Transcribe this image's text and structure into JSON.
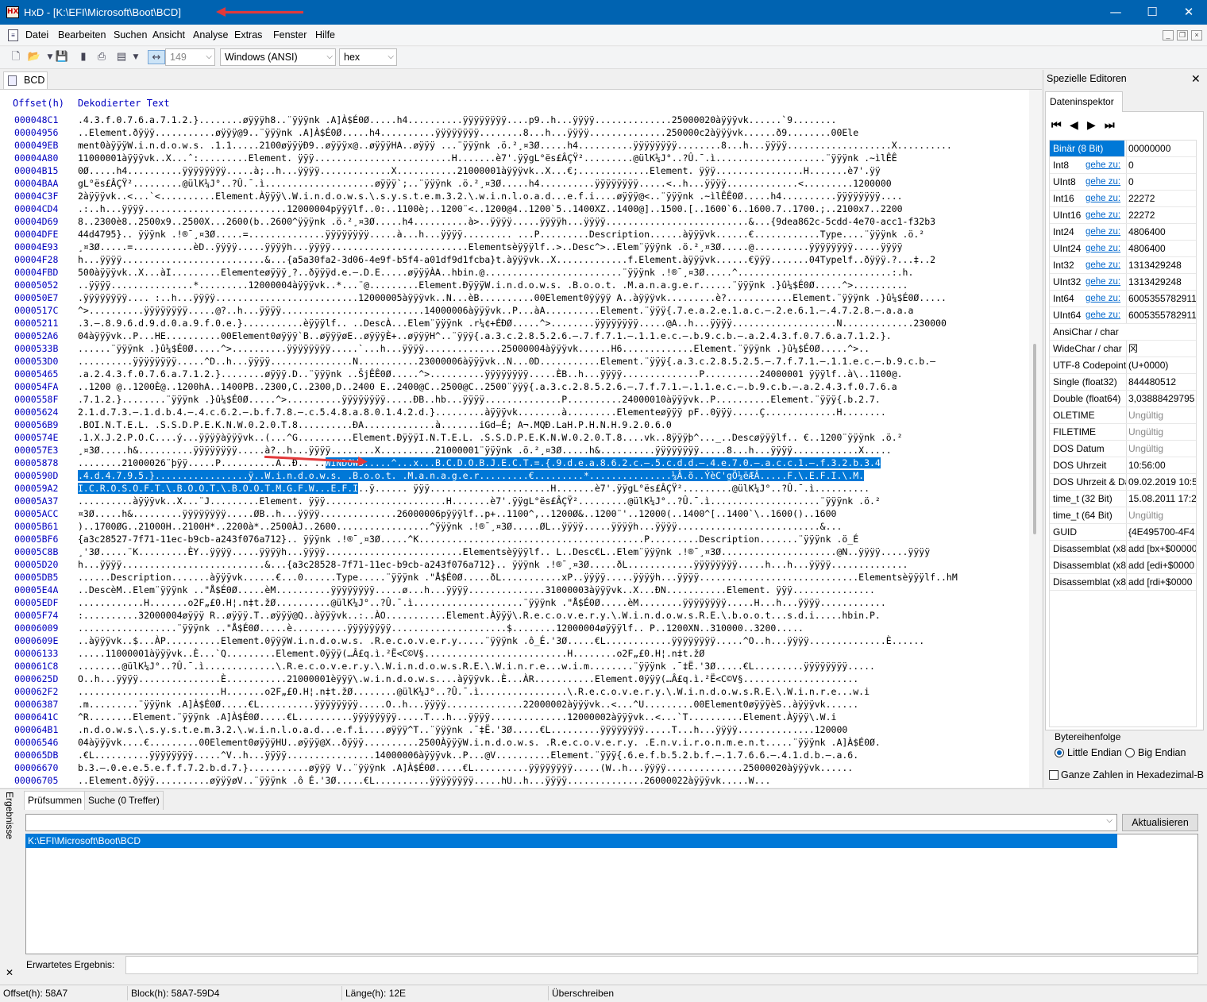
{
  "window": {
    "title": "HxD - [K:\\EFI\\Microsoft\\Boot\\BCD]",
    "app_icon": "hxd-icon",
    "minimize": "—",
    "maximize": "☐",
    "close": "✕"
  },
  "menu": [
    "Datei",
    "Bearbeiten",
    "Suchen",
    "Ansicht",
    "Analyse",
    "Extras",
    "Fenster",
    "Hilfe"
  ],
  "toolbar": {
    "bytes_per_row": "149",
    "charset": "Windows (ANSI)",
    "mode": "hex"
  },
  "document_tab": "BCD",
  "editor": {
    "header_offset": "Offset(h)",
    "header_text": "Dekodierter Text",
    "rows": [
      {
        "off": "000048C1",
        "txt": ".4.3.f.0.7.6.a.7.1.2.}........øÿÿÿh8..¨ÿÿÿnk .A]À$É0Ø.....h4..........ÿÿÿÿÿÿÿÿ....p9..h...ÿÿÿÿ..............25000020àÿÿÿvk......`9........"
      },
      {
        "off": "00004956",
        "txt": "..Element.ðÿÿÿ...........øÿÿÿ@9..¨ÿÿÿnk .A]À$É0Ø.....h4..........ÿÿÿÿÿÿÿÿ........8...h...ÿÿÿÿ..............250000c2àÿÿÿvk......ð9........00Ele"
      },
      {
        "off": "000049EB",
        "txt": "ment0àÿÿÿW.i.n.d.o.w.s. .1.1.....2100øÿÿÿÐ9..øÿÿÿx@..øÿÿÿHA..øÿÿÿ ...¨ÿÿÿnk .ö.²¸¤3Ø.....h4..........ÿÿÿÿÿÿÿÿ........8...h...ÿÿÿÿ...................X.........."
      },
      {
        "off": "00004A80",
        "txt": "11000001àÿÿÿvk..X...ˆ:.........Element. ÿÿÿ.........................H.......è7'.ÿÿgL°ës£ÂÇŸ².........@ülK¼J°..?Û.¯.ì....................¨ÿÿÿnk .~ìlÊÊ"
      },
      {
        "off": "00004B15",
        "txt": "0Ø.....h4..........ÿÿÿÿÿÿÿÿ.....à;..h...ÿÿÿÿ.............X...........21000001àÿÿÿvk..X...€;.............Element. ÿÿÿ................H.......è7'.ÿÿ"
      },
      {
        "off": "00004BAA",
        "txt": "gL°ës£ÂÇŸ².........@ülK¼J°..?Û.¯.ì....................øÿÿÿ`;..¨ÿÿÿnk .ö.²¸¤3Ø.....h4..........ÿÿÿÿÿÿÿÿ.....<..h...ÿÿÿÿ.............<.........1200000"
      },
      {
        "off": "00004C3F",
        "txt": "2àÿÿÿvk..<...`<..........Element.Àÿÿÿ\\.W.i.n.d.o.w.s.\\.s.y.s.t.e.m.3.2.\\.w.i.n.l.o.a.d...e.f.i....øÿÿÿ@<..¨ÿÿÿnk .~ìlÊÊ0Ø.....h4..........ÿÿÿÿÿÿÿÿ...."
      },
      {
        "off": "00004CD4",
        "txt": ".:..h...ÿÿÿÿ..........................12000004pÿÿÿlf..0:..1100è;..1200¨<..1200@4..1200`5..1400XZ..1400@]..1500.[..1600`6..1600.7..1700.;..2100x7..2200"
      },
      {
        "off": "00004D69",
        "txt": "8..2300è8..2500x9..2500X...2600(b..2600^ÿÿÿnk .ö.²¸¤3Ø.....h4..........à>..ÿÿÿÿ.....ÿÿÿÿh...ÿÿÿÿ..........................&...{9dea862c-5cdd-4e70-acc1-f32b3"
      },
      {
        "off": "00004DFE",
        "txt": "44d4795}.. ÿÿÿnk .!®¯¸¤3Ø.....=..............ÿÿÿÿÿÿÿÿ.....à...h...ÿÿÿÿ......... ...P.........Description......àÿÿÿvk......€............Type....¨ÿÿÿnk .ö.²"
      },
      {
        "off": "00004E93",
        "txt": "¸¤3Ø.....=...........èD..ÿÿÿÿ.....ÿÿÿÿh...ÿÿÿÿ.........................Elementsèÿÿÿlf..>..Desc^>..Elem¨ÿÿÿnk .ö.²¸¤3Ø.....@..........ÿÿÿÿÿÿÿÿ.....ÿÿÿÿ"
      },
      {
        "off": "00004F28",
        "txt": "h...ÿÿÿÿ..........................&...{a5a30fa2-3d06-4e9f-b5f4-a01df9d1fcba}t.àÿÿÿvk..X.............f.Element.àÿÿÿvk......€ÿÿÿ.......04Typelf..ðÿÿÿ.?...‡..2"
      },
      {
        "off": "00004FBD",
        "txt": "500àÿÿÿvk..X...àI.........Elementeøÿÿÿ¸?..ðÿÿÿd.e.–.D.E.....øÿÿÿÀA..hbin.@.........................¨ÿÿÿnk .!®¯¸¤3Ø.....^............................:.h."
      },
      {
        "off": "00005052",
        "txt": "..ÿÿÿÿ...............*.........12000004àÿÿÿvk..*...¨@.........Element.ÐÿÿÿW.i.n.d.o.w.s. .B.o.o.t. .M.a.n.a.g.e.r......¨ÿÿÿnk .}û¼$É0Ø.....^>.........."
      },
      {
        "off": "000050E7",
        "txt": ".ÿÿÿÿÿÿÿÿ.... :..h...ÿÿÿÿ..........................12000005àÿÿÿvk..N...èB..........00Element0ÿÿÿÿ A..àÿÿÿvk.........è?............Element.¨ÿÿÿnk .}û¼$É0Ø....."
      },
      {
        "off": "0000517C",
        "txt": "^>..........ÿÿÿÿÿÿÿÿ.....@?..h...ÿÿÿÿ..........................14000006àÿÿÿvk..P...àA..........Element.¨ÿÿÿ{.7.e.a.2.e.1.a.c.–.2.e.6.1.–.4.7.2.8.–.a.a.a"
      },
      {
        "off": "00005211",
        "txt": ".3.–.8.9.6.d.9.d.0.a.9.f.0.e.}...........èÿÿÿlf.. ..DescÀ...Elem¨ÿÿÿnk .r¼¢+ÉÐØ.....^>........ÿÿÿÿÿÿÿÿ.....@A..h...ÿÿÿÿ...................N.............230000"
      },
      {
        "off": "000052A6",
        "txt": "04àÿÿÿvk..P...HE..........00Element0øÿÿÿ`B..øÿÿÿøE..øÿÿÿÈ+..øÿÿÿH^..¨ÿÿÿ{.a.3.c.2.8.5.2.6.–.7.f.7.1.–.1.1.e.c.–.b.9.c.b.–.a.2.4.3.f.0.7.6.a.7.1.2.}."
      },
      {
        "off": "0000533B",
        "txt": "......¨ÿÿÿnk .}û¼$É0Ø.....^>..........ÿÿÿÿÿÿÿÿ.....`...h...ÿÿÿÿ..............25000004àÿÿÿvk......H6.............Element.¨ÿÿÿnk .}û¼$É0Ø.....^>.."
      },
      {
        "off": "000053D0",
        "txt": "..........ÿÿÿÿÿÿÿÿ.....^D..h...ÿÿÿÿ...............N...........23000006àÿÿÿvk..N...0D...........Element.¨ÿÿÿ{.a.3.c.2.8.5.2.5.–.7.f.7.1.–.1.1.e.c.–.b.9.c.b.–"
      },
      {
        "off": "00005465",
        "txt": ".a.2.4.3.f.0.7.6.a.7.1.2.}........øÿÿÿ.D..¨ÿÿÿnk ..ŠjÊÊ0Ø.....^>..........ÿÿÿÿÿÿÿÿ.....ÈB..h...ÿÿÿÿ..............P..........24000001 ÿÿÿlf..à\\..1100@."
      },
      {
        "off": "000054FA",
        "txt": "..1200 @..1200È@..1200hA..1400PB..2300,C..2300,D..2400 E..2400@C..2500@C..2500¨ÿÿÿ{.a.3.c.2.8.5.2.6.–.7.f.7.1.–.1.1.e.c.–.b.9.c.b.–.a.2.4.3.f.0.7.6.a"
      },
      {
        "off": "0000558F",
        "txt": ".7.1.2.}........¨ÿÿÿnk .}û¼$É0Ø.....^>..........ÿÿÿÿÿÿÿÿ.....ÐB..hb...ÿÿÿÿ..............P..........24000010àÿÿÿvk..P..........Element.¨ÿÿÿ{.b.2.7."
      },
      {
        "off": "00005624",
        "txt": "2.1.d.7.3.–.1.d.b.4.–.4.c.6.2.–.b.f.7.8.–.c.5.4.8.a.8.0.1.4.2.d.}.........àÿÿÿvk........à.........Elementeøÿÿÿ pF..0ÿÿÿ.....Ç.............H........"
      },
      {
        "off": "000056B9",
        "txt": ".BOI.N.T.E.L. .S.S.D.P.E.K.N.W.0.2.0.T.8..........ÐA.............à.......iGd–É; A¬.MQÐ.LaH.P.H.N.H.9.2.0.6.0"
      },
      {
        "off": "0000574E",
        "txt": ".1.X.J.2.P.O.C....ý...ÿÿÿÿàÿÿÿvk..(...^G..........Element.ÐÿÿÿI.N.T.E.L. .S.S.D.P.E.K.N.W.0.2.0.T.8....vk..8ÿÿÿþ^..._..Descøÿÿÿlf.. €..1200¨ÿÿÿnk .ö.²"
      },
      {
        "off": "000057E3",
        "txt": "¸¤3Ø.....h&..........ÿÿÿÿÿÿÿÿ.....à?..h...ÿÿÿÿ........X..........21000001¨ÿÿÿnk .ö.²¸¤3Ø.....h&..........ÿÿÿÿÿÿÿÿ.....8...h...ÿÿÿÿ............X....."
      },
      {
        "off": "00005878",
        "txt": "........21000026¨þÿÿ.....P..........A..Ð..¨..",
        "sel": "WINDOWS.....^...x...B.C.D.O.B.J.E.C.T.=.{.9.d.e.a.8.6.2.c.–.5.c.d.d.–.4.e.7.0.–.a.c.c.1.–.f.3.2.b.3.4"
      },
      {
        "off": "0000590D",
        "txt": "",
        "sel": ".4.d.4.7.9.5.}.................ÿ..W.i.n.d.o.w.s. .B.o.o.t. .M.a.n.a.g.e.r.........€.........*...............¼Â.õ..ÝèC'gÖ¼ëÆÂ.....F.\\.E.F.I.\\.M."
      },
      {
        "off": "000059A2",
        "txt": "..ÿ...... ÿÿÿ......................H.......è7'.ÿÿgL°ës£ÂÇŸ².........@ülK¼J°..?Û.¯.ì..........",
        "sel": "I.C.R.O.S.O.F.T.\\.B.O.O.T.\\.B.O.O.T.M.G.F.W...E.F.I"
      },
      {
        "off": "00005A37",
        "txt": "..........àÿÿÿvk..X...¨J.........Element. ÿÿÿ......................H.......è7'.ÿÿgL°ës£ÂÇŸ².........@ülK¼J°..?Û.¯.ì....................¨ÿÿÿnk .ö.²"
      },
      {
        "off": "00005ACC",
        "txt": "¤3Ø.....h&.........ÿÿÿÿÿÿÿÿ.....ØB..h...ÿÿÿÿ..............26000006pÿÿÿlf..p+..1100^,..1200Ø&..1200¨'..12000(..1400^[..1400`\\..1600()..1600"
      },
      {
        "off": "00005B61",
        "txt": ")..1700ØG..21000H..2100H*..2200à*..2500ÀJ..2600.................^ÿÿÿnk .!®¯¸¤3Ø.....ØL..ÿÿÿÿ.....ÿÿÿÿh...ÿÿÿÿ..........................&..."
      },
      {
        "off": "00005BF6",
        "txt": "{a3c28527-7f71-11ec-b9cb-a243f076a712}.. ÿÿÿnk .!®¯¸¤3Ø.....^K.........................................P.........Description.......¨ÿÿÿnk .ö_É"
      },
      {
        "off": "00005C8B",
        "txt": "¸'3Ø.....¨K.........ÈY..ÿÿÿÿ.....ÿÿÿÿh...ÿÿÿÿ.........................Elementsèÿÿÿlf.. L..Desc€L..Elem¨ÿÿÿnk .!®¯¸¤3Ø.....................@N..ÿÿÿÿ.....ÿÿÿÿ"
      },
      {
        "off": "00005D20",
        "txt": "h...ÿÿÿÿ..........................&...{a3c28528-7f71-11ec-b9cb-a243f076a712}.. ÿÿÿnk .!®¯¸¤3Ø.....ðL............ÿÿÿÿÿÿÿÿ.....h...h...ÿÿÿÿ.............."
      },
      {
        "off": "00005DB5",
        "txt": "......Description.......àÿÿÿvk......€...0......Type.....¨ÿÿÿnk .\"Å$É0Ø.....ðL...........xP..ÿÿÿÿ.....ÿÿÿÿh...ÿÿÿÿ.............................Elementsèÿÿÿlf..hM"
      },
      {
        "off": "00005E4A",
        "txt": "..DescèM..Elem¨ÿÿÿnk ..\"Å$É0Ø.....èM..........ÿÿÿÿÿÿÿÿ.....ø...h...ÿÿÿÿ..............31000003àÿÿÿvk..X...ÐN...........Element. ÿÿÿ..............."
      },
      {
        "off": "00005EDF",
        "txt": "............H.......o2F„£0.H¦.n‡t.žØ..........@ülK¼J°..?Û.¯.ì....................¨ÿÿÿnk .\"Å$É0Ø.....èM........ÿÿÿÿÿÿÿÿ.....H...h...ÿÿÿÿ............"
      },
      {
        "off": "00005F74",
        "txt": ":..........32000004øÿÿÿ R..øÿÿÿ.T..øÿÿÿ@Q..àÿÿÿvk..:..ÀO...........Element.Àÿÿÿ\\.R.e.c.o.v.e.r.y.\\.W.i.n.d.o.w.s.R.E.\\.b.o.o.t...s.d.i.....hbin.P."
      },
      {
        "off": "00006009",
        "txt": "..................¨ÿÿÿnk ..\"Å$É0Ø.....è..........ÿÿÿÿÿÿÿÿ.....................$........12000004øÿÿÿlf.. P..1200XN..310000..3200....."
      },
      {
        "off": "0000609E",
        "txt": "..àÿÿÿvk..$...ÀP..........Element.0ÿÿÿW.i.n.d.o.w.s. .R.e.c.o.v.e.r.y.....¨ÿÿÿnk .ô_É.'3Ø.....€L............ÿÿÿÿÿÿÿÿ.....^O..h...ÿÿÿÿ..............È......"
      },
      {
        "off": "00006133",
        "txt": ".....11000001àÿÿÿvk..È...`Q.........Element.0ÿÿÿ(…Â£q.ì.²Ë<C©V§..........................H........o2F„£0.H¦.n‡t.žØ"
      },
      {
        "off": "000061C8",
        "txt": "........@ülK¼J°..?Û.¯.ì.............\\.R.e.c.o.v.e.r.y.\\.W.i.n.d.o.w.s.R.E.\\.W.i.n.r.e...w.i.m........¨ÿÿÿnk .¯‡Ë.'3Ø.....€L.........ÿÿÿÿÿÿÿÿ....."
      },
      {
        "off": "0000625D",
        "txt": "O..h...ÿÿÿÿ...............È...........21000001èÿÿÿ\\.w.i.n.d.o.w.s....àÿÿÿvk..È...ÀR...........Element.0ÿÿÿ(…Â£q.ì.²Ë<C©V§....................."
      },
      {
        "off": "000062F2",
        "txt": "..........................H.......o2F„£0.H¦.n‡t.žØ........@ülK¼J°..?Û.¯.ì................\\.R.e.c.o.v.e.r.y.\\.W.i.n.d.o.w.s.R.E.\\.W.i.n.r.e...w.i"
      },
      {
        "off": "00006387",
        "txt": ".m.........¨ÿÿÿnk .A]À$É0Ø.....€L..........ÿÿÿÿÿÿÿÿ.....O..h...ÿÿÿÿ..............22000002àÿÿÿvk..<...^U.........00Element0øÿÿÿèS..àÿÿÿvk......"
      },
      {
        "off": "0000641C",
        "txt": "^R........Element.¨ÿÿÿnk .A]À$É0Ø.....€L..........ÿÿÿÿÿÿÿÿ.....T...h...ÿÿÿÿ..............12000002àÿÿÿvk..<...`T..........Element.Àÿÿÿ\\.W.i"
      },
      {
        "off": "000064B1",
        "txt": ".n.d.o.w.s.\\.s.y.s.t.e.m.3.2.\\.w.i.n.l.o.a.d...e.f.i....øÿÿÿ^T..¨ÿÿÿnk .¯‡Ë.'3Ø.....€L.........ÿÿÿÿÿÿÿÿ.....T...h...ÿÿÿÿ..............120000"
      },
      {
        "off": "00006546",
        "txt": "04àÿÿÿvk....€.........00Element0øÿÿÿHU..øÿÿÿ@X..ðÿÿÿ..........2500ÀÿÿÿW.i.n.d.o.w.s. .R.e.c.o.v.e.r.y. .E.n.v.i.r.o.n.m.e.n.t.....¨ÿÿÿnk .A]À$É0Ø."
      },
      {
        "off": "000065DB",
        "txt": ".€L..........ÿÿÿÿÿÿÿÿ.....^V..h...ÿÿÿÿ................14000006àÿÿÿvk..P...@V..........Element.¨ÿÿÿ{.6.e.f.b.5.2.b.f.–.1.7.6.6.–.4.1.d.b.–.a.6."
      },
      {
        "off": "00006670",
        "txt": "b.3.–.0.e.e.5.e.f.f.7.2.b.d.7.}...........øÿÿÿ V..¨ÿÿÿnk .A]À$É0Ø.....€L..........ÿÿÿÿÿÿÿÿ.....(W..h...ÿÿÿÿ..............25000020àÿÿÿvk......"
      },
      {
        "off": "00006705",
        "txt": "..Element.ðÿÿÿ..........øÿÿÿøV..¨ÿÿÿnk .ô É.'3Ø.....€L..........ÿÿÿÿÿÿÿÿ.....hU..h...ÿÿÿÿ..............26000022àÿÿÿvk.....W..."
      }
    ]
  },
  "special_editors": {
    "title": "Spezielle Editoren",
    "close": "✕",
    "tab": "Dateninspektor",
    "link_label": "gehe zu:",
    "rows": [
      {
        "label": "Binär (8 Bit)",
        "value": "00000000",
        "selected": true
      },
      {
        "label": "Int8",
        "goto": true,
        "value": "0"
      },
      {
        "label": "UInt8",
        "goto": true,
        "value": "0"
      },
      {
        "label": "Int16",
        "goto": true,
        "value": "22272"
      },
      {
        "label": "UInt16",
        "goto": true,
        "value": "22272"
      },
      {
        "label": "Int24",
        "goto": true,
        "value": "4806400"
      },
      {
        "label": "UInt24",
        "goto": true,
        "value": "4806400"
      },
      {
        "label": "Int32",
        "goto": true,
        "value": "1313429248"
      },
      {
        "label": "UInt32",
        "goto": true,
        "value": "1313429248"
      },
      {
        "label": "Int64",
        "goto": true,
        "value": "6005355782911"
      },
      {
        "label": "UInt64",
        "goto": true,
        "value": "6005355782911"
      },
      {
        "label": "AnsiChar / char",
        "value": ""
      },
      {
        "label": "WideChar / char",
        "value": "冈"
      },
      {
        "label": "UTF-8 Codepoint",
        "value": "  (U+0000)"
      },
      {
        "label": "Single (float32)",
        "value": "844480512"
      },
      {
        "label": "Double (float64)",
        "value": "3,03888429795"
      },
      {
        "label": "OLETIME",
        "value": "Ungültig",
        "invalid": true
      },
      {
        "label": "FILETIME",
        "value": "Ungültig",
        "invalid": true
      },
      {
        "label": "DOS Datum",
        "value": "Ungültig",
        "invalid": true
      },
      {
        "label": "DOS Uhrzeit",
        "value": "10:56:00"
      },
      {
        "label": "DOS Uhrzeit & Datum",
        "value": "09.02.2019 10:5"
      },
      {
        "label": "time_t (32 Bit)",
        "value": "15.08.2011 17:2"
      },
      {
        "label": "time_t (64 Bit)",
        "value": "Ungültig",
        "invalid": true
      },
      {
        "label": "GUID",
        "value": "{4E495700-4F4"
      },
      {
        "label": "Disassemblat (x86-16)",
        "value": "add [bx+$00000"
      },
      {
        "label": "Disassemblat (x86-32)",
        "value": "add [edi+$0000"
      },
      {
        "label": "Disassemblat (x86-64)",
        "value": "add [rdi+$0000"
      }
    ],
    "byte_order_label": "Bytereihenfolge",
    "little_endian": "Little Endian",
    "big_endian": "Big Endian",
    "hex_ints": "Ganze Zahlen in Hexadezimal-B"
  },
  "results": {
    "side_label": "Ergebnisse",
    "side_close": "✕",
    "tabs": [
      "Prüfsummen",
      "Suche (0 Treffer)"
    ],
    "dropdown_item": "K:\\EFI\\Microsoft\\Boot\\BCD",
    "refresh": "Aktualisieren",
    "expected_label": "Erwartetes Ergebnis:"
  },
  "status": {
    "offset": "Offset(h): 58A7",
    "block": "Block(h): 58A7-59D4",
    "length": "Länge(h): 12E",
    "mode": "Überschreiben"
  },
  "colors": {
    "titlebar": "#0063b1",
    "selection": "#0078d7",
    "offset_text": "#0000c0",
    "annotation_arrow": "#e2393b"
  }
}
